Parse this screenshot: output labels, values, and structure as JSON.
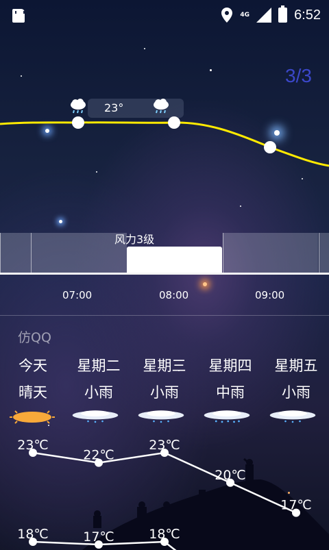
{
  "status_bar": {
    "network": "4G",
    "time": "6:52"
  },
  "page_indicator": "3/3",
  "hourly": {
    "bubble_temp": "23°",
    "wind_label": "风力3级",
    "times": [
      "07:00",
      "08:00",
      "09:00"
    ]
  },
  "brand": "仿QQ",
  "forecast": [
    {
      "day": "今天",
      "condition": "晴天",
      "icon": "sunny-icon",
      "high": "23℃",
      "low": "18℃"
    },
    {
      "day": "星期二",
      "condition": "小雨",
      "icon": "light-rain-icon",
      "high": "22℃",
      "low": "17℃"
    },
    {
      "day": "星期三",
      "condition": "小雨",
      "icon": "light-rain-icon",
      "high": "23℃",
      "low": "18℃"
    },
    {
      "day": "星期四",
      "condition": "中雨",
      "icon": "moderate-rain-icon",
      "high": "20℃",
      "low": ""
    },
    {
      "day": "星期五",
      "condition": "小雨",
      "icon": "light-rain-icon",
      "high": "17℃",
      "low": ""
    }
  ],
  "colors": {
    "hour_line": "#ffea00",
    "page_indicator": "#3b47c9"
  }
}
